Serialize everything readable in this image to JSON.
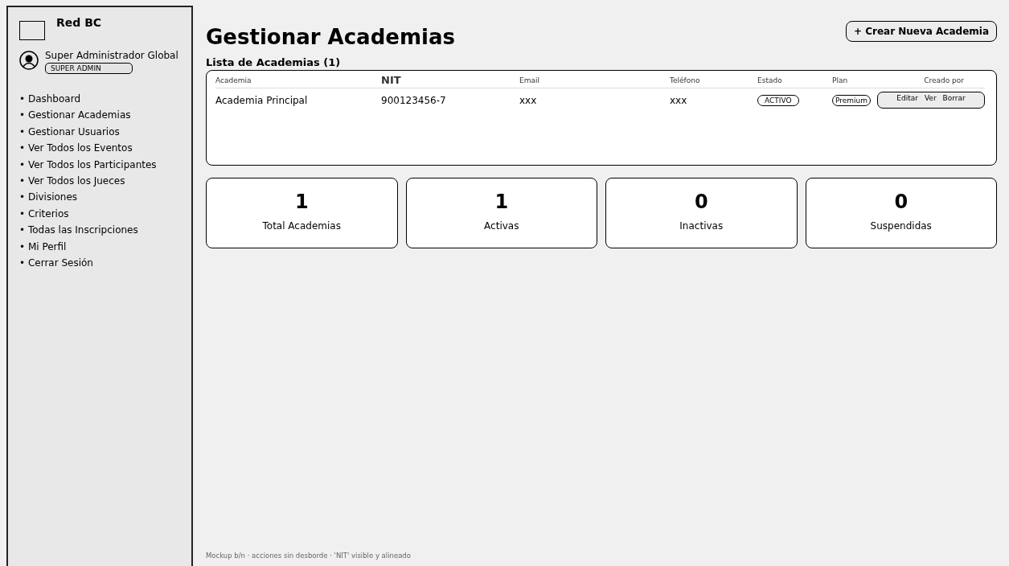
{
  "sidebar": {
    "brand": "Red BC",
    "user": {
      "name": "Super Administrador Global",
      "role": "SUPER ADMIN"
    },
    "items": [
      {
        "label": "• Dashboard"
      },
      {
        "label": "• Gestionar Academias"
      },
      {
        "label": "• Gestionar Usuarios"
      },
      {
        "label": "• Ver Todos los Eventos"
      },
      {
        "label": "• Ver Todos los Participantes"
      },
      {
        "label": "• Ver Todos los Jueces"
      },
      {
        "label": "• Divisiones"
      },
      {
        "label": "• Criterios"
      },
      {
        "label": "• Todas las Inscripciones"
      },
      {
        "label": "• Mi Perfil"
      },
      {
        "label": "• Cerrar Sesión"
      }
    ]
  },
  "page": {
    "title": "Gestionar Academias",
    "create_button": "+ Crear Nueva Academia"
  },
  "table": {
    "title": "Lista de Academias (1)",
    "columns": [
      "Academia",
      "NIT",
      "Email",
      "Teléfono",
      "Estado",
      "Plan",
      "Creado por"
    ],
    "rows": [
      {
        "academia": "Academia Principal",
        "nit": "900123456-7",
        "email": "xxx",
        "telefono": "xxx",
        "estado": "ACTIVO",
        "plan": "Premium",
        "actions": [
          "Editar",
          "Ver",
          "Borrar"
        ]
      }
    ]
  },
  "stats": [
    {
      "value": "1",
      "label": "Total Academias"
    },
    {
      "value": "1",
      "label": "Activas"
    },
    {
      "value": "0",
      "label": "Inactivas"
    },
    {
      "value": "0",
      "label": "Suspendidas"
    }
  ],
  "footer_note": "Mockup b/n · acciones sin desborde · 'NIT' visible y alineado"
}
